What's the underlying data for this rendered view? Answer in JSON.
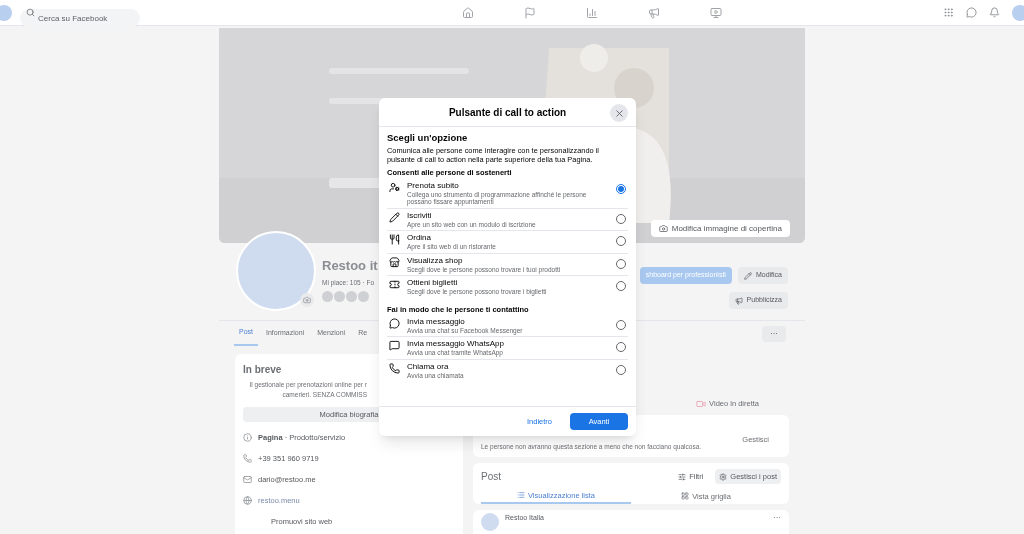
{
  "top_bar": {
    "search": {
      "placeholder": "Cerca su Facebook"
    }
  },
  "cover": {
    "kind": "picture",
    "edit_button": "Modifica immagine di copertina"
  },
  "profile": {
    "name": "Restoo it",
    "stats": "Mi piace: 105 · Fo",
    "actions": [
      {
        "label": "shboard per professionisti",
        "kind": "primary"
      },
      {
        "label": "Modifica",
        "kind": "edit"
      },
      {
        "label": "Pubblicizza",
        "kind": "promote"
      }
    ],
    "more": "···"
  },
  "tabs": [
    {
      "label": "Post",
      "selected": true
    },
    {
      "label": "Informazioni",
      "selected": false
    },
    {
      "label": "Menzioni",
      "selected": false
    },
    {
      "label": "Re",
      "selected": false
    }
  ],
  "intro": {
    "title": "In breve",
    "bio": [
      "Il gestionale per prenotazioni online per r",
      "camerieri. SENZA COMMISS"
    ],
    "edit_bio": "Modifica biografia",
    "details": [
      {
        "kind": "page",
        "bold": "Pagina",
        "text": " · Prodotto/servizio"
      },
      {
        "kind": "phone",
        "text": "+39 351 960 9719"
      },
      {
        "kind": "email",
        "text": "dario@restoo.me"
      },
      {
        "kind": "web",
        "text": "restoo.menu"
      }
    ],
    "promote": "Promuovi sito web"
  },
  "right": {
    "live": "Video in diretta",
    "notice": "Le persone non avranno questa sezione a meno che non facciano qualcosa.",
    "manage": "Gestisci",
    "posts": {
      "title": "Post",
      "filters": "Filtri",
      "manage_posts": "Gestisci i post",
      "views": [
        {
          "label": "Visualizzazione lista",
          "selected": true
        },
        {
          "label": "Vista griglia",
          "selected": false
        }
      ],
      "author": "Restoo Italia",
      "more": "···"
    }
  },
  "dialog": {
    "title": "Pulsante di call to action",
    "heading": "Scegli un'opzione",
    "description": "Comunica alle persone come interagire con te personalizzando il pulsante di call to action nella parte superiore della tua Pagina.",
    "groups": [
      {
        "title": "Consenti alle persone di sostenerti",
        "options": [
          {
            "kind": "booking",
            "label": "Prenota subito",
            "description": "Collega uno strumento di programmazione affinché le persone possano fissare appuntamenti",
            "selected": true
          },
          {
            "kind": "signup",
            "label": "Iscriviti",
            "description": "Apre un sito web con un modulo di iscrizione",
            "selected": false
          },
          {
            "kind": "order",
            "label": "Ordina",
            "description": "Apre il sito web di un ristorante",
            "selected": false
          },
          {
            "kind": "shop",
            "label": "Visualizza shop",
            "description": "Scegli dove le persone possono trovare i tuoi prodotti",
            "selected": false
          },
          {
            "kind": "tickets",
            "label": "Ottieni biglietti",
            "description": "Scegli dove le persone possono trovare i biglietti",
            "selected": false
          }
        ]
      },
      {
        "title": "Fai in modo che le persone ti contattino",
        "options": [
          {
            "kind": "message",
            "label": "Invia messaggio",
            "description": "Avvia una chat su Facebook Messenger",
            "selected": false
          },
          {
            "kind": "whatsapp",
            "label": "Invia messaggio WhatsApp",
            "description": "Avvia una chat tramite WhatsApp",
            "selected": false
          },
          {
            "kind": "call",
            "label": "Chiama ora",
            "description": "Avvia una chiamata",
            "selected": false
          }
        ]
      }
    ],
    "back": "Indietro",
    "next": "Avanti"
  }
}
